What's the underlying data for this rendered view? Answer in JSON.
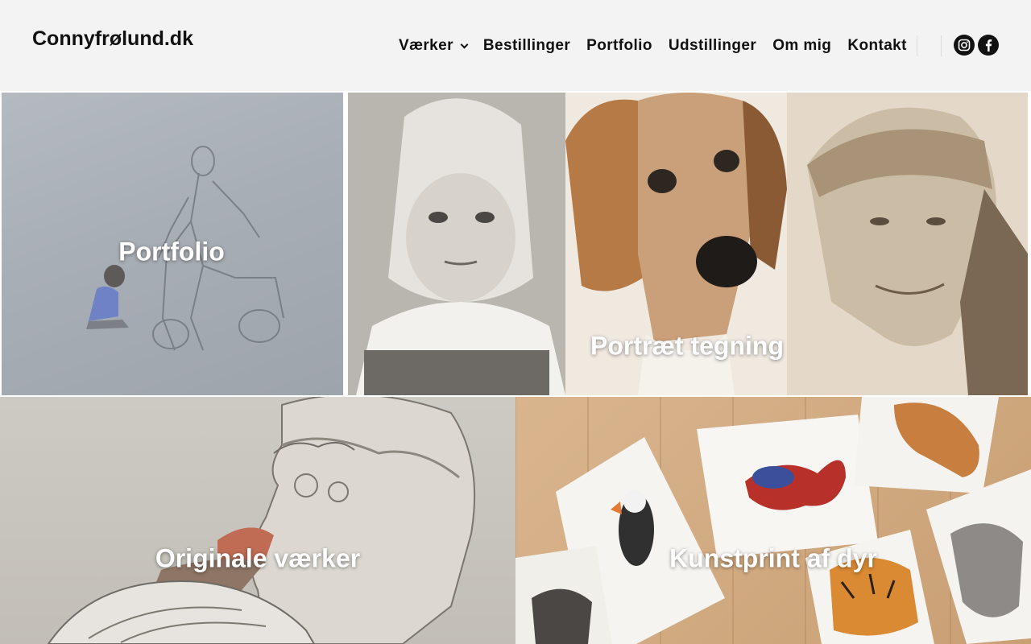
{
  "header": {
    "logo": "Connyfrølund.dk",
    "nav": [
      {
        "label": "Værker",
        "has_dropdown": true
      },
      {
        "label": "Bestillinger"
      },
      {
        "label": "Portfolio"
      },
      {
        "label": "Udstillinger"
      },
      {
        "label": "Om mig"
      },
      {
        "label": "Kontakt"
      }
    ],
    "social": [
      {
        "icon": "instagram-icon"
      },
      {
        "icon": "facebook-icon"
      }
    ]
  },
  "tiles": {
    "portfolio": {
      "label": "Portfolio"
    },
    "portraet": {
      "label": "Portræt tegning"
    },
    "originale": {
      "label": "Originale værker"
    },
    "kunstprint": {
      "label": "Kunstprint af dyr"
    }
  },
  "colors": {
    "header_bg": "#f3f3f3",
    "text": "#111111",
    "tile_label": "#ffffff"
  }
}
